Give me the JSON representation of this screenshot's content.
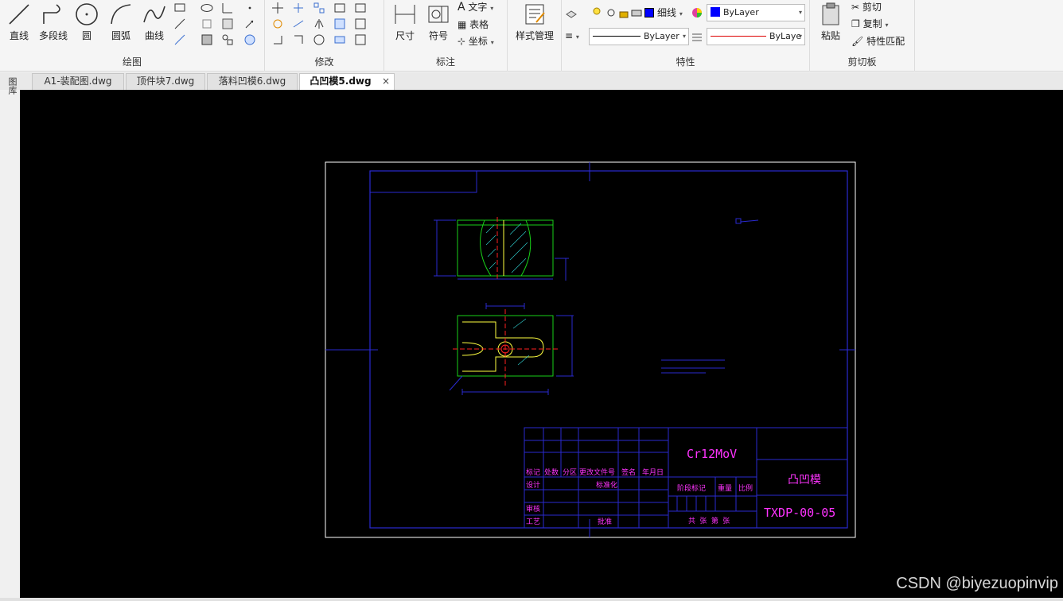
{
  "ribbon": {
    "draw_group": {
      "label": "绘图",
      "line": "直线",
      "polyline": "多段线",
      "circle": "圆",
      "arc": "圆弧",
      "curve": "曲线"
    },
    "modify_group": {
      "label": "修改"
    },
    "annotate_group": {
      "label": "标注",
      "dimension": "尺寸",
      "symbol": "符号",
      "text": "文字",
      "table": "表格",
      "coordinate": "坐标"
    },
    "style_group": {
      "style_manager": "样式管理"
    },
    "properties_group": {
      "label": "特性",
      "lineweight_label": "细线",
      "color_value": "ByLayer",
      "linetype_value": "ByLayer",
      "linetype2_value": "ByLaye"
    },
    "clipboard_group": {
      "label": "剪切板",
      "paste": "粘贴",
      "cut": "剪切",
      "copy": "复制",
      "match_props": "特性匹配"
    }
  },
  "tabs": [
    {
      "label": "A1-装配图.dwg",
      "active": false
    },
    {
      "label": "顶件块7.dwg",
      "active": false
    },
    {
      "label": "落料凹模6.dwg",
      "active": false
    },
    {
      "label": "凸凹模5.dwg",
      "active": true
    }
  ],
  "side_tool": {
    "label": "图库"
  },
  "title_block": {
    "material": "Cr12MoV",
    "part_name": "凸凹模",
    "drawing_no": "TXDP-00-05",
    "row_labels": [
      "标记",
      "处数",
      "分区",
      "更改文件号",
      "签名",
      "年月日"
    ],
    "designer": "设计",
    "standardize": "标准化",
    "stage_mark": "阶段标记",
    "weight": "重量",
    "scale": "比例",
    "review": "审核",
    "process": "工艺",
    "approve": "批准",
    "sheets": "共 张 第 张"
  },
  "watermark": "CSDN @biyezuopinvip",
  "colors": {
    "canvas_bg": "#000000",
    "frame_white": "#ffffff",
    "frame_blue": "#2424c8",
    "part_green": "#18d018",
    "text_magenta": "#ff33ff",
    "center_red": "#ff2020",
    "accent_yellow": "#ffff40",
    "hatch_cyan": "#30d0d0"
  }
}
